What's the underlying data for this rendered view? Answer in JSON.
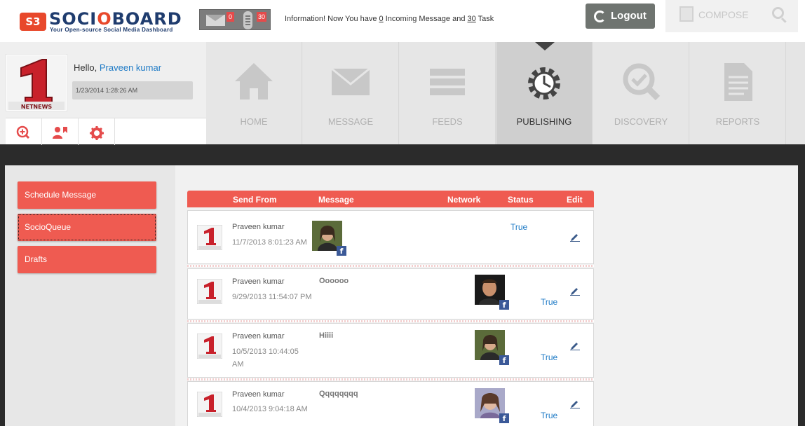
{
  "brand": {
    "badge": "S3",
    "name_part1": "SOCI",
    "name_o": "O",
    "name_part2": "BOARD",
    "tagline": "Your Open-source Social Media Dashboard"
  },
  "notifications": {
    "messages_count": "0",
    "tasks_count": "30",
    "info_prefix": "Information! Now You have ",
    "info_messages": "0",
    "info_middle": " Incoming Message and ",
    "info_tasks": "30",
    "info_suffix": " Task"
  },
  "header": {
    "logout_label": "Logout",
    "compose_label": "COMPOSE"
  },
  "profile": {
    "hello_label": "Hello,",
    "user_name": "Praveen kumar",
    "datetime": "1/23/2014 1:28:26 AM",
    "avatar_text": "NETNEWS"
  },
  "nav": [
    {
      "label": "HOME",
      "icon": "home-icon"
    },
    {
      "label": "MESSAGE",
      "icon": "envelope-icon"
    },
    {
      "label": "FEEDS",
      "icon": "feeds-icon"
    },
    {
      "label": "PUBLISHING",
      "icon": "gear-clock-icon",
      "active": true
    },
    {
      "label": "DISCOVERY",
      "icon": "magnifier-check-icon"
    },
    {
      "label": "REPORTS",
      "icon": "document-icon"
    }
  ],
  "sidebar": {
    "items": [
      {
        "label": "Schedule Message"
      },
      {
        "label": "SocioQueue",
        "selected": true
      },
      {
        "label": "Drafts"
      }
    ]
  },
  "table": {
    "headers": {
      "send_from": "Send From",
      "message": "Message",
      "network": "Network",
      "status": "Status",
      "edit": "Edit"
    },
    "rows": [
      {
        "name": "Praveen kumar",
        "date": "11/7/2013 8:01:23 AM",
        "message": "",
        "status": "True",
        "network": "facebook"
      },
      {
        "name": "Praveen kumar",
        "date": "9/29/2013 11:54:07 PM",
        "message": "Oooooo",
        "status": "True",
        "network": "facebook"
      },
      {
        "name": "Praveen kumar",
        "date": "10/5/2013 10:44:05 AM",
        "message": "Hiiii",
        "status": "True",
        "network": "facebook"
      },
      {
        "name": "Praveen kumar",
        "date": "10/4/2013 9:04:18 AM",
        "message": "Qqqqqqqq",
        "status": "True",
        "network": "facebook"
      }
    ]
  },
  "colors": {
    "accent_red": "#ef5b51",
    "link_blue": "#1f7bc6",
    "facebook": "#3b5998"
  }
}
